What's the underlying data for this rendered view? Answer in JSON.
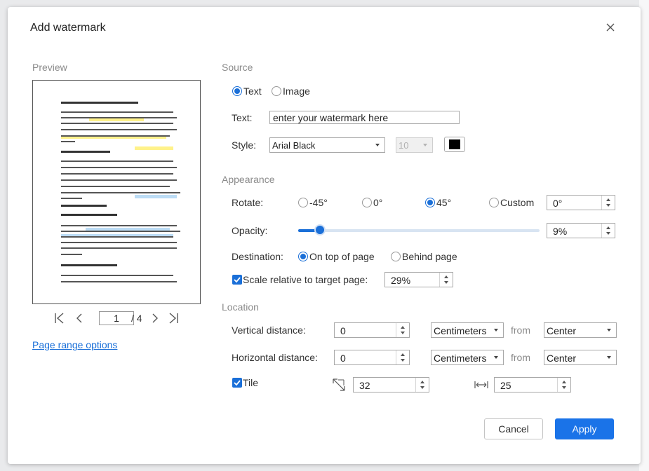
{
  "dialog": {
    "title": "Add watermark"
  },
  "preview": {
    "label": "Preview",
    "current_page": "1",
    "total_pages": "/ 4",
    "page_range_link": "Page range options"
  },
  "source": {
    "label": "Source",
    "options": [
      "Text",
      "Image"
    ],
    "selected": "Text",
    "text_label": "Text:",
    "text_value": "enter your watermark here",
    "style_label": "Style:",
    "font": "Arial Black",
    "font_size": "10",
    "color": "#000000"
  },
  "appearance": {
    "label": "Appearance",
    "rotate_label": "Rotate:",
    "rotate_options": [
      "-45°",
      "0°",
      "45°",
      "Custom"
    ],
    "rotate_selected": "45°",
    "custom_value": "0°",
    "opacity_label": "Opacity:",
    "opacity_value": "9%",
    "opacity_fraction": 0.09,
    "destination_label": "Destination:",
    "destination_options": [
      "On top of page",
      "Behind page"
    ],
    "destination_selected": "On top of page",
    "scale_label": "Scale relative to target page:",
    "scale_checked": true,
    "scale_value": "29%"
  },
  "location": {
    "label": "Location",
    "vertical_label": "Vertical distance:",
    "vertical_value": "0",
    "vertical_unit": "Centimeters",
    "vertical_from": "Center",
    "horizontal_label": "Horizontal distance:",
    "horizontal_value": "0",
    "horizontal_unit": "Centimeters",
    "horizontal_from": "Center",
    "from_label": "from",
    "tile_label": "Tile",
    "tile_checked": true,
    "tile_vertical_spacing": "32",
    "tile_horizontal_spacing": "25"
  },
  "buttons": {
    "cancel": "Cancel",
    "apply": "Apply"
  },
  "colors": {
    "accent": "#1a73e8",
    "link": "#1a6fd8"
  }
}
